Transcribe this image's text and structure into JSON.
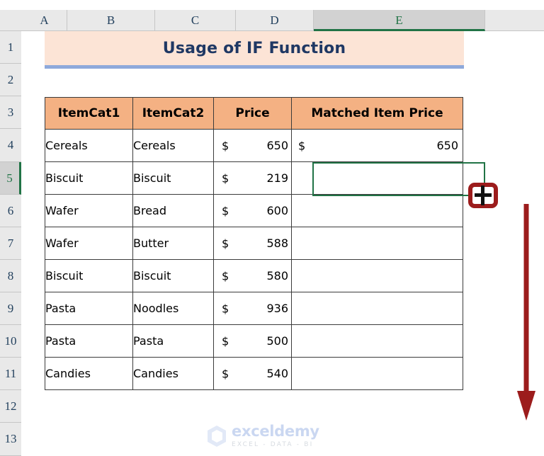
{
  "app": {
    "type": "spreadsheet",
    "selected_cell": "E5",
    "selected_column": "E",
    "selected_row": "5"
  },
  "colors": {
    "header_fill": "#F4B183",
    "title_fill": "#FCE4D6",
    "title_text": "#1F3864",
    "title_underline": "#8EA9DB",
    "selection_border": "#217346",
    "annotation": "#9C1C1C",
    "sheet_chrome": "#E9E9E9"
  },
  "column_headers": [
    {
      "label": "A",
      "selected": false
    },
    {
      "label": "B",
      "selected": false
    },
    {
      "label": "C",
      "selected": false
    },
    {
      "label": "D",
      "selected": false
    },
    {
      "label": "E",
      "selected": true
    }
  ],
  "row_headers": [
    {
      "label": "1",
      "selected": false
    },
    {
      "label": "2",
      "selected": false
    },
    {
      "label": "3",
      "selected": false
    },
    {
      "label": "4",
      "selected": false
    },
    {
      "label": "5",
      "selected": true
    },
    {
      "label": "6",
      "selected": false
    },
    {
      "label": "7",
      "selected": false
    },
    {
      "label": "8",
      "selected": false
    },
    {
      "label": "9",
      "selected": false
    },
    {
      "label": "10",
      "selected": false
    },
    {
      "label": "11",
      "selected": false
    },
    {
      "label": "12",
      "selected": false
    },
    {
      "label": "13",
      "selected": false
    }
  ],
  "title": {
    "text": "Usage of IF Function"
  },
  "table": {
    "headers": [
      "ItemCat1",
      "ItemCat2",
      "Price",
      "Matched Item Price"
    ],
    "currency_symbol": "$",
    "rows": [
      {
        "item_cat1": "Cereals",
        "item_cat2": "Cereals",
        "price": "650",
        "matched": "650",
        "matched_filled": true
      },
      {
        "item_cat1": "Biscuit",
        "item_cat2": "Biscuit",
        "price": "219",
        "matched": "",
        "matched_filled": false
      },
      {
        "item_cat1": "Wafer",
        "item_cat2": "Bread",
        "price": "600",
        "matched": "",
        "matched_filled": false
      },
      {
        "item_cat1": "Wafer",
        "item_cat2": "Butter",
        "price": "588",
        "matched": "",
        "matched_filled": false
      },
      {
        "item_cat1": "Biscuit",
        "item_cat2": "Biscuit",
        "price": "580",
        "matched": "",
        "matched_filled": false
      },
      {
        "item_cat1": "Pasta",
        "item_cat2": "Noodles",
        "price": "936",
        "matched": "",
        "matched_filled": false
      },
      {
        "item_cat1": "Pasta",
        "item_cat2": "Pasta",
        "price": "500",
        "matched": "",
        "matched_filled": false
      },
      {
        "item_cat1": "Candies",
        "item_cat2": "Candies",
        "price": "540",
        "matched": "",
        "matched_filled": false
      }
    ]
  },
  "annotations": {
    "fill_handle_icon": "fill-handle-crosshair-icon",
    "arrow_icon": "down-arrow-icon",
    "arrow_direction": "down"
  },
  "watermark": {
    "name": "exceldemy",
    "tagline": "EXCEL - DATA - BI",
    "logo_icon": "exceldemy-cube-logo-icon"
  }
}
